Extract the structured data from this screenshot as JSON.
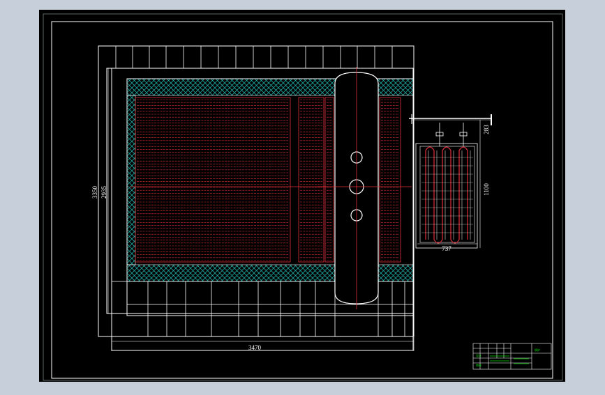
{
  "viewport": {
    "background": "#c7cfdb"
  },
  "drawing": {
    "background": "#000000",
    "line_color": "#ffffff",
    "tube_color": "#e0303a",
    "insulation_color": "#1fa7a0",
    "accent_color": "#00e000"
  },
  "dimensions": {
    "overall_width": "3470",
    "outer_height": "3350",
    "inner_height": "2935",
    "economizer_height": "1100",
    "economizer_width": "737",
    "economizer_offset": "283"
  },
  "title_block": {
    "rows": 5,
    "green_labels": [
      "锅炉",
      "设计",
      "审核"
    ]
  }
}
